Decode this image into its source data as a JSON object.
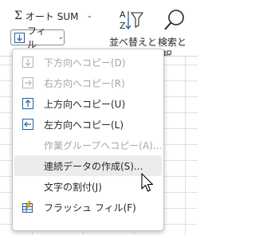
{
  "ribbon": {
    "autosum_label": "オート SUM",
    "fill_label": "フィル",
    "sort_filter_label": "並べ替えと",
    "find_select_line1": "検索と",
    "find_select_line2": "択"
  },
  "fill_menu": {
    "items": [
      {
        "label": "下方向へコピー(D)",
        "icon": "fill-down-icon",
        "enabled": false
      },
      {
        "label": "右方向へコピー(R)",
        "icon": "fill-right-icon",
        "enabled": false
      },
      {
        "label": "上方向へコピー(U)",
        "icon": "fill-up-icon",
        "enabled": true
      },
      {
        "label": "左方向へコピー(L)",
        "icon": "fill-left-icon",
        "enabled": true
      },
      {
        "label": "作業グループへコピー(A)...",
        "icon": "",
        "enabled": false
      },
      {
        "label": "連続データの作成(S)...",
        "icon": "",
        "enabled": true,
        "hovered": true
      },
      {
        "label": "文字の割付(J)",
        "icon": "",
        "enabled": true
      },
      {
        "label": "フラッシュ フィル(F)",
        "icon": "flash-fill-icon",
        "enabled": true
      }
    ]
  },
  "colors": {
    "accent": "#1e5fa8",
    "disabled_text": "#a6a6a6",
    "hover_bg": "#ebebeb"
  }
}
